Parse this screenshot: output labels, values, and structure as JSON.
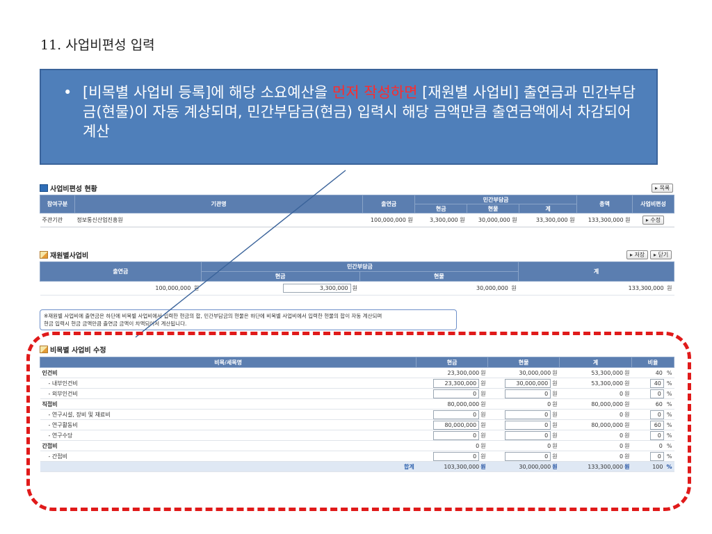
{
  "slide": {
    "title": "11. 사업비편성 입력",
    "bullet": "•",
    "callout_part1": "[비목별 사업비 등록]에 해당 소요예산을 ",
    "callout_highlight": "먼저 작성하면",
    "callout_part2": " [재원별 사업비] 출연금과 민간부담금(현물)이 자동 계상되며, 민간부담금(현금) 입력시 해당 금액만큼 출연금액에서 차감되어 계산"
  },
  "status_section": {
    "title": "사업비편성 현황",
    "list_button": "목록",
    "headers": {
      "participation": "참여구분",
      "org_name": "기관명",
      "contribution": "출연금",
      "private": "민간부담금",
      "cash": "현금",
      "in_kind": "현물",
      "subtotal": "계",
      "total": "총액",
      "budget": "사업비편성"
    },
    "row": {
      "participation": "주관기관",
      "org_name": "정보통신산업진흥원",
      "contribution": "100,000,000 원",
      "cash": "3,300,000 원",
      "in_kind": "30,000,000 원",
      "subtotal": "33,300,000 원",
      "total": "133,300,000 원",
      "edit_button": "수정"
    }
  },
  "source_section": {
    "title": "재원별사업비",
    "save_button": "저장",
    "close_button": "닫기",
    "headers": {
      "contribution": "출연금",
      "private": "민간부담금",
      "cash": "현금",
      "in_kind": "현물",
      "total": "계"
    },
    "row": {
      "contribution": "100,000,000",
      "cash": "3,300,000",
      "in_kind": "30,000,000",
      "total": "133,300,000",
      "unit": "원"
    }
  },
  "note": {
    "line1": "※재원별 사업비에 출연금은 하단에 비목별 사업비에서 입력한 현금의 합, 민간부담금의 현물은 하단에 비목별 사업비에서 입력한 현물의 합이 자동 계산되며",
    "line2": "현금 입력시 현금 금액만큼 출연금 금액이 차액되어서 계산됩니다."
  },
  "items_section": {
    "title": "비목별 사업비 수정",
    "headers": {
      "name": "비목/세목명",
      "cash": "현금",
      "in_kind": "현물",
      "total": "계",
      "ratio": "비율"
    },
    "unit": "원",
    "pct": "%",
    "rows": [
      {
        "name": "인건비",
        "cash": "23,300,000",
        "in_kind": "30,000,000",
        "total": "53,300,000",
        "ratio": "40"
      },
      {
        "name": "- 내부인건비",
        "cash": "23,300,000",
        "in_kind": "30,000,000",
        "total": "53,300,000",
        "ratio": "40"
      },
      {
        "name": "- 외부인건비",
        "cash": "0",
        "in_kind": "0",
        "total": "0",
        "ratio": "0"
      },
      {
        "name": "직접비",
        "cash": "80,000,000",
        "in_kind": "0",
        "total": "80,000,000",
        "ratio": "60"
      },
      {
        "name": "- 연구시설, 장비 및 재료비",
        "cash": "0",
        "in_kind": "0",
        "total": "0",
        "ratio": "0"
      },
      {
        "name": "- 연구활동비",
        "cash": "80,000,000",
        "in_kind": "0",
        "total": "80,000,000",
        "ratio": "60"
      },
      {
        "name": "- 연구수당",
        "cash": "0",
        "in_kind": "0",
        "total": "0",
        "ratio": "0"
      },
      {
        "name": "간접비",
        "cash": "0",
        "in_kind": "0",
        "total": "0",
        "ratio": "0"
      },
      {
        "name": "- 간접비",
        "cash": "0",
        "in_kind": "0",
        "total": "0",
        "ratio": "0"
      }
    ],
    "total_row": {
      "label": "합계",
      "cash": "103,300,000",
      "in_kind": "30,000,000",
      "total": "133,300,000",
      "ratio": "100"
    }
  },
  "colors": {
    "callout_bg": "#4f7fba",
    "highlight": "#ff2b2b",
    "header_bg": "#5b7eb0",
    "dashed_frame": "#e01a1a"
  }
}
